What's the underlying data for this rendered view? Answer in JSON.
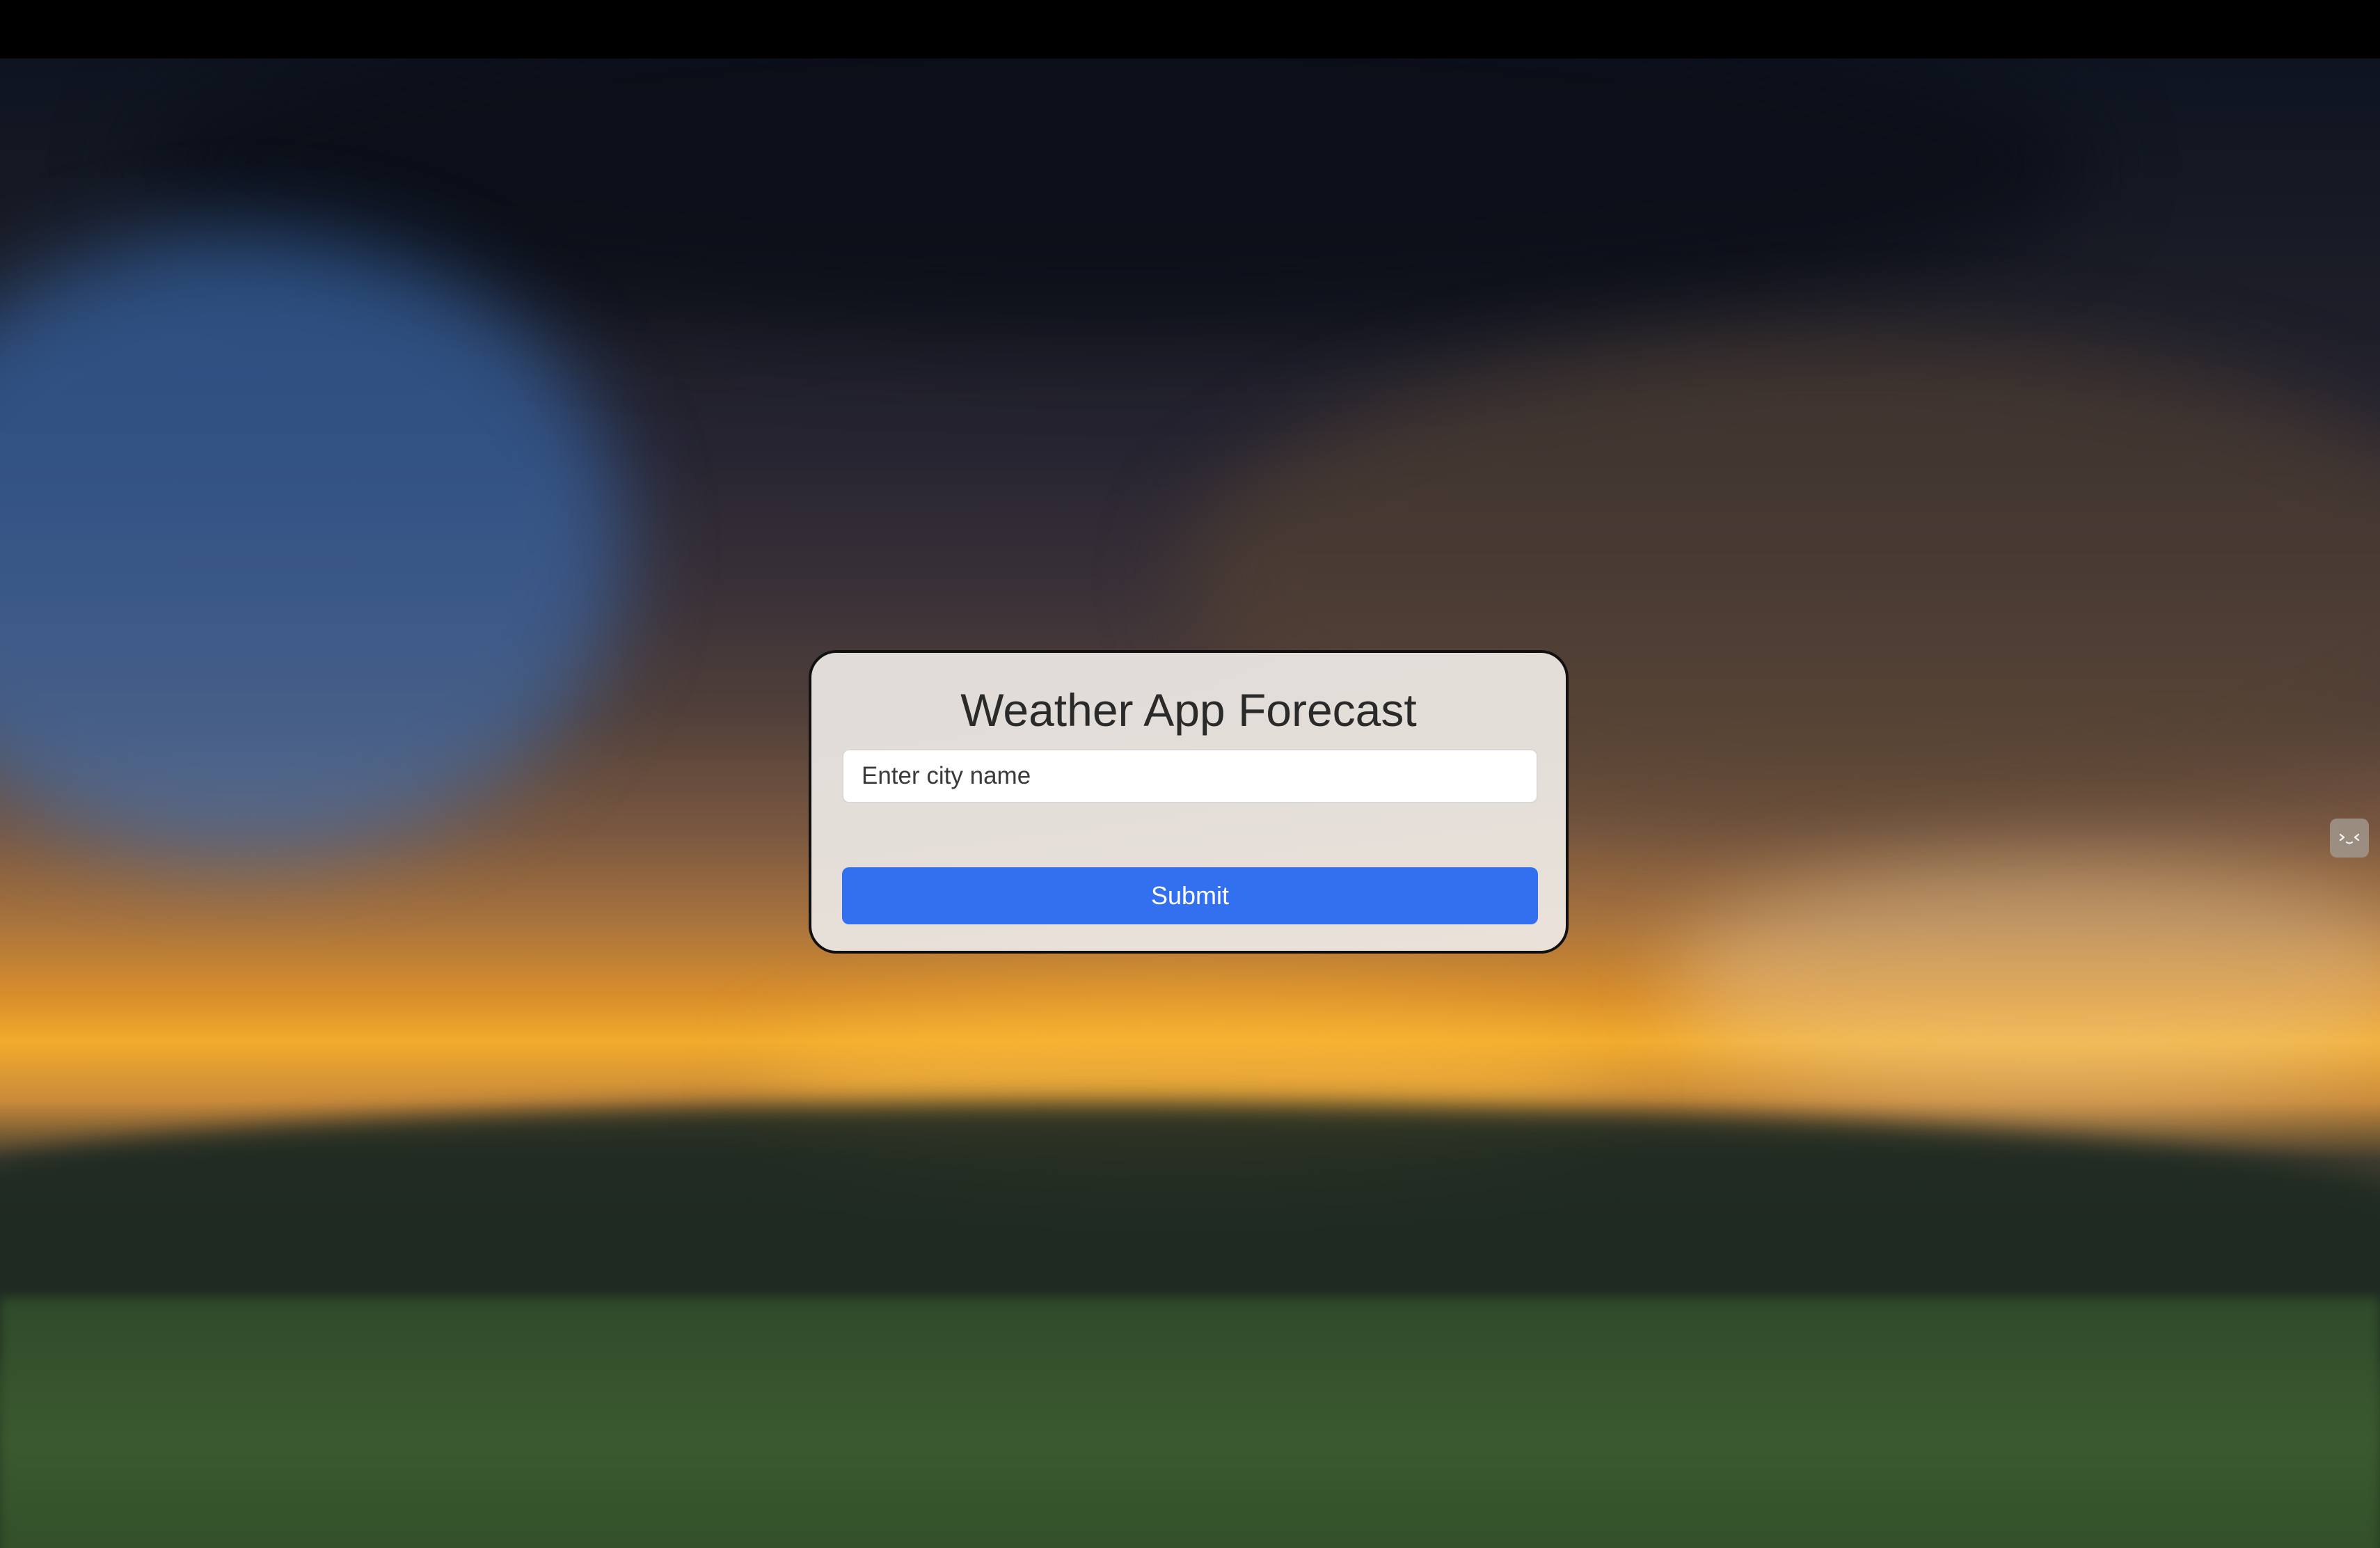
{
  "app": {
    "title": "Weather App Forecast"
  },
  "search": {
    "placeholder": "Enter city name",
    "value": ""
  },
  "form": {
    "submit_label": "Submit"
  },
  "colors": {
    "submit_button": "#3370ef",
    "card_border": "#111111",
    "card_background": "#e6e2de"
  },
  "icons": {
    "floating_widget": "face-icon"
  }
}
